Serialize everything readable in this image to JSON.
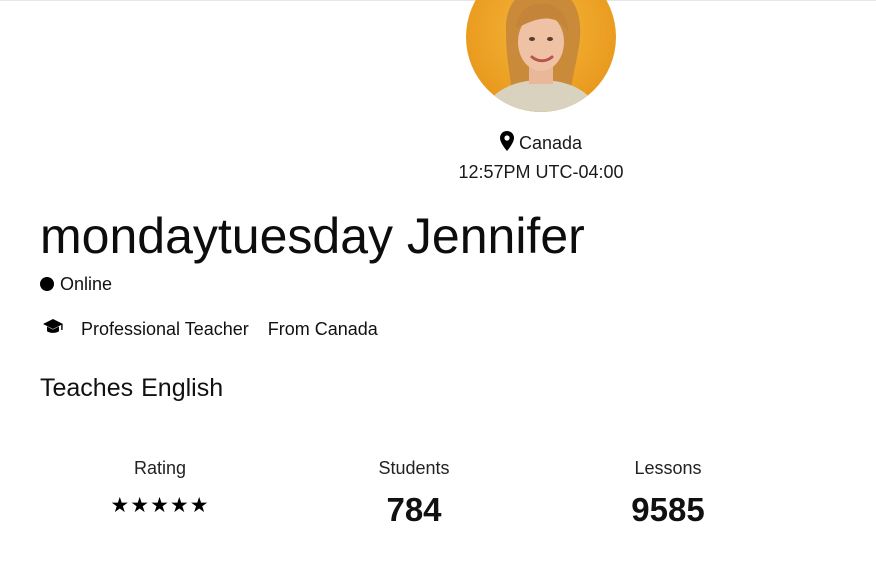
{
  "profile": {
    "country": "Canada",
    "local_time": "12:57PM UTC-04:00",
    "name": "mondaytuesday Jennifer",
    "status": "Online",
    "teacher_type": "Professional Teacher",
    "from": "From Canada",
    "teaches_label": "Teaches",
    "teaches_language": "English"
  },
  "stats": {
    "rating_label": "Rating",
    "rating_stars": "★★★★★",
    "rating_value": 5,
    "rating_max": 5,
    "students_label": "Students",
    "students_value": "784",
    "lessons_label": "Lessons",
    "lessons_value": "9585"
  },
  "icons": {
    "location": "map-pin-icon",
    "teacher": "graduation-cap-icon",
    "online": "status-dot-icon"
  },
  "colors": {
    "text": "#111111",
    "online_dot": "#000000",
    "avatar_background": "#f0a320"
  }
}
